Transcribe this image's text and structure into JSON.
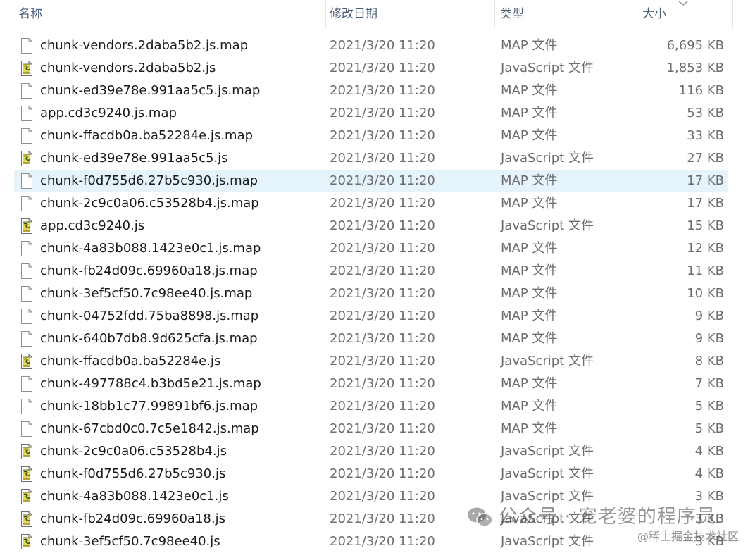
{
  "columns": {
    "name": "名称",
    "date": "修改日期",
    "type": "类型",
    "size": "大小"
  },
  "files": [
    {
      "name": "chunk-vendors.2daba5b2.js.map",
      "date": "2021/3/20 11:20",
      "type": "MAP 文件",
      "size": "6,695 KB",
      "icon": "map-file-icon"
    },
    {
      "name": "chunk-vendors.2daba5b2.js",
      "date": "2021/3/20 11:20",
      "type": "JavaScript 文件",
      "size": "1,853 KB",
      "icon": "javascript-file-icon"
    },
    {
      "name": "chunk-ed39e78e.991aa5c5.js.map",
      "date": "2021/3/20 11:20",
      "type": "MAP 文件",
      "size": "116 KB",
      "icon": "map-file-icon"
    },
    {
      "name": "app.cd3c9240.js.map",
      "date": "2021/3/20 11:20",
      "type": "MAP 文件",
      "size": "53 KB",
      "icon": "map-file-icon"
    },
    {
      "name": "chunk-ffacdb0a.ba52284e.js.map",
      "date": "2021/3/20 11:20",
      "type": "MAP 文件",
      "size": "33 KB",
      "icon": "map-file-icon"
    },
    {
      "name": "chunk-ed39e78e.991aa5c5.js",
      "date": "2021/3/20 11:20",
      "type": "JavaScript 文件",
      "size": "27 KB",
      "icon": "javascript-file-icon"
    },
    {
      "name": "chunk-f0d755d6.27b5c930.js.map",
      "date": "2021/3/20 11:20",
      "type": "MAP 文件",
      "size": "17 KB",
      "icon": "map-file-icon",
      "selected": true
    },
    {
      "name": "chunk-2c9c0a06.c53528b4.js.map",
      "date": "2021/3/20 11:20",
      "type": "MAP 文件",
      "size": "17 KB",
      "icon": "map-file-icon"
    },
    {
      "name": "app.cd3c9240.js",
      "date": "2021/3/20 11:20",
      "type": "JavaScript 文件",
      "size": "15 KB",
      "icon": "javascript-file-icon"
    },
    {
      "name": "chunk-4a83b088.1423e0c1.js.map",
      "date": "2021/3/20 11:20",
      "type": "MAP 文件",
      "size": "12 KB",
      "icon": "map-file-icon"
    },
    {
      "name": "chunk-fb24d09c.69960a18.js.map",
      "date": "2021/3/20 11:20",
      "type": "MAP 文件",
      "size": "11 KB",
      "icon": "map-file-icon"
    },
    {
      "name": "chunk-3ef5cf50.7c98ee40.js.map",
      "date": "2021/3/20 11:20",
      "type": "MAP 文件",
      "size": "10 KB",
      "icon": "map-file-icon"
    },
    {
      "name": "chunk-04752fdd.75ba8898.js.map",
      "date": "2021/3/20 11:20",
      "type": "MAP 文件",
      "size": "9 KB",
      "icon": "map-file-icon"
    },
    {
      "name": "chunk-640b7db8.9d625cfa.js.map",
      "date": "2021/3/20 11:20",
      "type": "MAP 文件",
      "size": "9 KB",
      "icon": "map-file-icon"
    },
    {
      "name": "chunk-ffacdb0a.ba52284e.js",
      "date": "2021/3/20 11:20",
      "type": "JavaScript 文件",
      "size": "8 KB",
      "icon": "javascript-file-icon"
    },
    {
      "name": "chunk-497788c4.b3bd5e21.js.map",
      "date": "2021/3/20 11:20",
      "type": "MAP 文件",
      "size": "7 KB",
      "icon": "map-file-icon"
    },
    {
      "name": "chunk-18bb1c77.99891bf6.js.map",
      "date": "2021/3/20 11:20",
      "type": "MAP 文件",
      "size": "5 KB",
      "icon": "map-file-icon"
    },
    {
      "name": "chunk-67cbd0c0.7c5e1842.js.map",
      "date": "2021/3/20 11:20",
      "type": "MAP 文件",
      "size": "5 KB",
      "icon": "map-file-icon"
    },
    {
      "name": "chunk-2c9c0a06.c53528b4.js",
      "date": "2021/3/20 11:20",
      "type": "JavaScript 文件",
      "size": "4 KB",
      "icon": "javascript-file-icon"
    },
    {
      "name": "chunk-f0d755d6.27b5c930.js",
      "date": "2021/3/20 11:20",
      "type": "JavaScript 文件",
      "size": "4 KB",
      "icon": "javascript-file-icon"
    },
    {
      "name": "chunk-4a83b088.1423e0c1.js",
      "date": "2021/3/20 11:20",
      "type": "JavaScript 文件",
      "size": "3 KB",
      "icon": "javascript-file-icon"
    },
    {
      "name": "chunk-fb24d09c.69960a18.js",
      "date": "2021/3/20 11:20",
      "type": "JavaScript 文件",
      "size": "3 KB",
      "icon": "javascript-file-icon"
    },
    {
      "name": "chunk-3ef5cf50.7c98ee40.js",
      "date": "2021/3/20 11:20",
      "type": "JavaScript 文件",
      "size": "3 KB",
      "icon": "javascript-file-icon"
    }
  ],
  "watermark": {
    "main": "公众号 · 宠老婆的程序员",
    "sub": "@稀土掘金技术社区",
    "icon": "wechat-icon"
  },
  "colors": {
    "selected_row": "#e5f3fb",
    "header_text": "#4c607a",
    "js_icon_yellow": "#e8d44d"
  }
}
